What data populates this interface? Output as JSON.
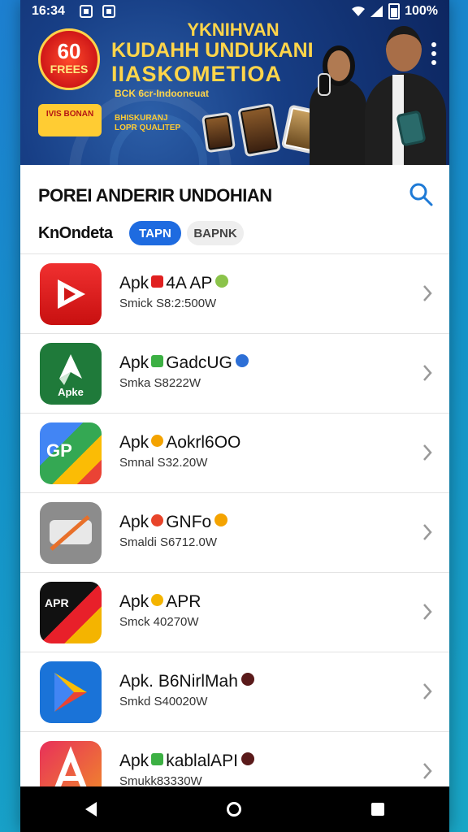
{
  "status_bar": {
    "time": "16:34",
    "battery": "100%"
  },
  "banner": {
    "badge_number": "60",
    "badge_text": "FREES",
    "headline_1": "YKNIHVAN",
    "headline_2": "KUDAHH UNDUKANI",
    "headline_3": "IIASKOMETIOA",
    "subline": "BCK 6cr-Indooneuat",
    "tag_left": "IVIS BONAN",
    "tag_right": "BHISKURANJ LOPR QUALITEP"
  },
  "header": {
    "title": "POREI ANDERIR UNDOHIAN",
    "subtitle": "KnOndeta",
    "chips": [
      "TAPN",
      "BAPNK"
    ]
  },
  "apps": [
    {
      "name": "Apk",
      "tag_color": "#e02020",
      "title": "4A AP",
      "badge_color": "#8bc34a",
      "meta": "Smick S8:2:500W"
    },
    {
      "name": "Apk",
      "tag_color": "#3cb043",
      "title": "GadcUG",
      "badge_color": "#2d6fd6",
      "meta": "Smka S8222W"
    },
    {
      "name": "Apk",
      "tag_color": "#f4a300",
      "title": "Aokrl6OO",
      "badge_color": "",
      "meta": "Smnal S32.20W"
    },
    {
      "name": "Apk",
      "tag_color": "#e8442a",
      "title": "GNFo",
      "badge_color": "#f4a300",
      "meta": "Smaldi S6712.0W"
    },
    {
      "name": "Apk",
      "tag_color": "#f4b400",
      "title": "APR",
      "badge_color": "",
      "meta": "Smck 40270W"
    },
    {
      "name": "Apk.",
      "tag_color": "",
      "title": "B6NirlMah",
      "badge_color": "#5a1a1a",
      "meta": "Smkd S40020W"
    },
    {
      "name": "Apk",
      "tag_color": "#3cb043",
      "title": "kablalAPI",
      "badge_color": "#5a1a1a",
      "meta": "Smukk83330W"
    }
  ],
  "icon_labels": {
    "app2": "Apke",
    "app3": "GP",
    "app5": "APR"
  },
  "colors": {
    "accent": "#1e6be0",
    "banner_yellow": "#ffd54a"
  }
}
